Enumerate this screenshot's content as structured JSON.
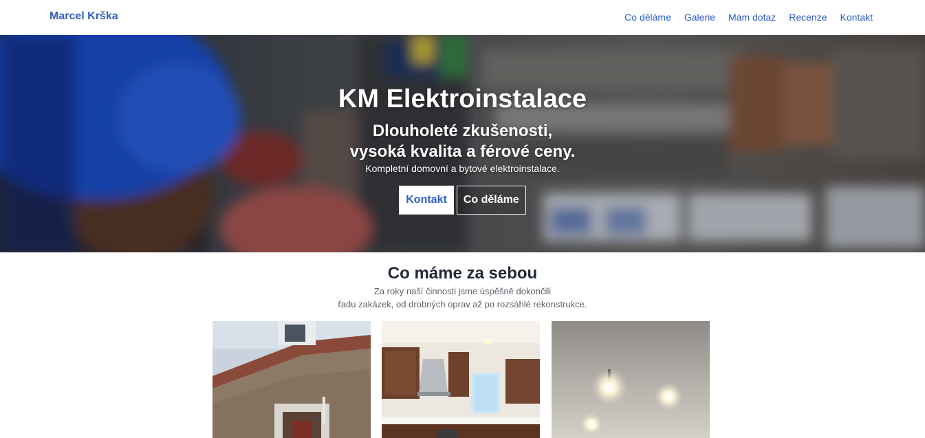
{
  "navbar": {
    "brand": "Marcel Krška",
    "links": [
      "Co děláme",
      "Galerie",
      "Mám dotaz",
      "Recenze",
      "Kontakt"
    ]
  },
  "hero": {
    "title": "KM Elektroinstalace",
    "subtitle_line1": "Dlouholeté zkušenosti,",
    "subtitle_line2": "vysoká kvalita a férové ceny.",
    "description": "Kompletní domovní a bytové elektroinstalace.",
    "buttons": {
      "primary": "Kontakt",
      "secondary": "Co děláme"
    }
  },
  "projects": {
    "title": "Co máme za sebou",
    "desc_line1": "Za roky naší činnosti jsme úspěšně dokončili",
    "desc_line2": "řadu zakázek, od drobných oprav až po rozsáhlé rekonstrukce."
  },
  "colors": {
    "accent": "#2f5fc4",
    "heading": "#222a35",
    "muted": "#5b636b"
  }
}
